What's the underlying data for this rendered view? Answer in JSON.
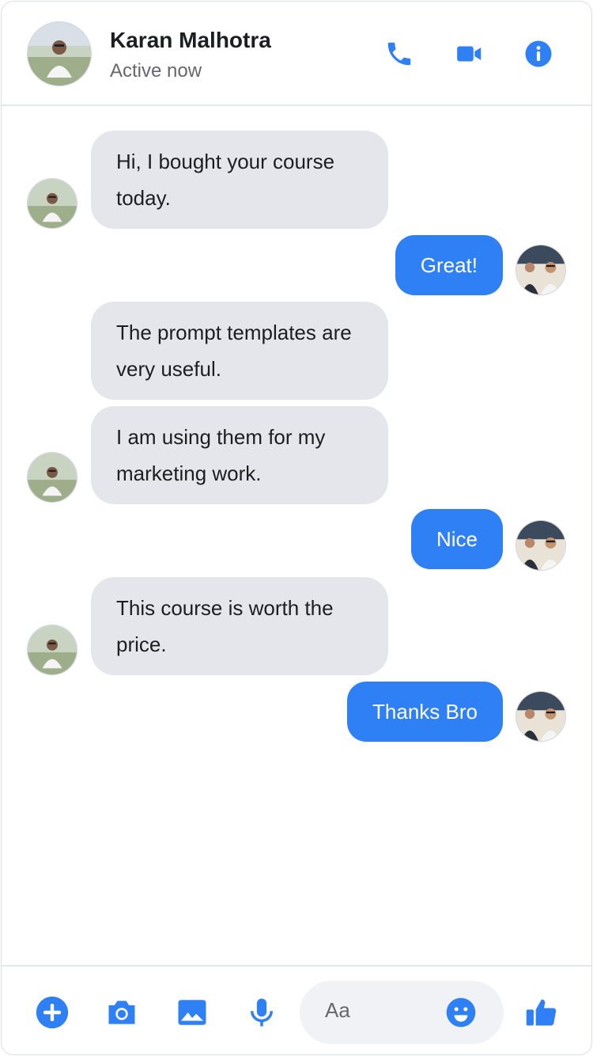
{
  "header": {
    "contact_name": "Karan Malhotra",
    "status": "Active now",
    "actions": [
      {
        "icon": "phone-icon"
      },
      {
        "icon": "video-camera-icon"
      },
      {
        "icon": "info-icon"
      }
    ]
  },
  "messages": [
    {
      "direction": "in",
      "text": "Hi, I bought your course today."
    },
    {
      "direction": "out",
      "text": "Great!"
    },
    {
      "direction": "in",
      "text": "The prompt templates are very useful."
    },
    {
      "direction": "in",
      "text": "I am using them for my marketing work."
    },
    {
      "direction": "out",
      "text": "Nice"
    },
    {
      "direction": "in",
      "text": "This course is worth the price."
    },
    {
      "direction": "out",
      "text": "Thanks Bro"
    }
  ],
  "composer": {
    "placeholder": "Aa",
    "actions": [
      {
        "icon": "plus-circle-icon"
      },
      {
        "icon": "camera-icon"
      },
      {
        "icon": "image-icon"
      },
      {
        "icon": "microphone-icon"
      }
    ],
    "emoji_icon": "smiley-icon",
    "like_icon": "thumbs-up-icon"
  },
  "colors": {
    "accent": "#2f80f5",
    "incoming_bubble": "#e4e6eb",
    "input_background": "#f0f2f5"
  }
}
